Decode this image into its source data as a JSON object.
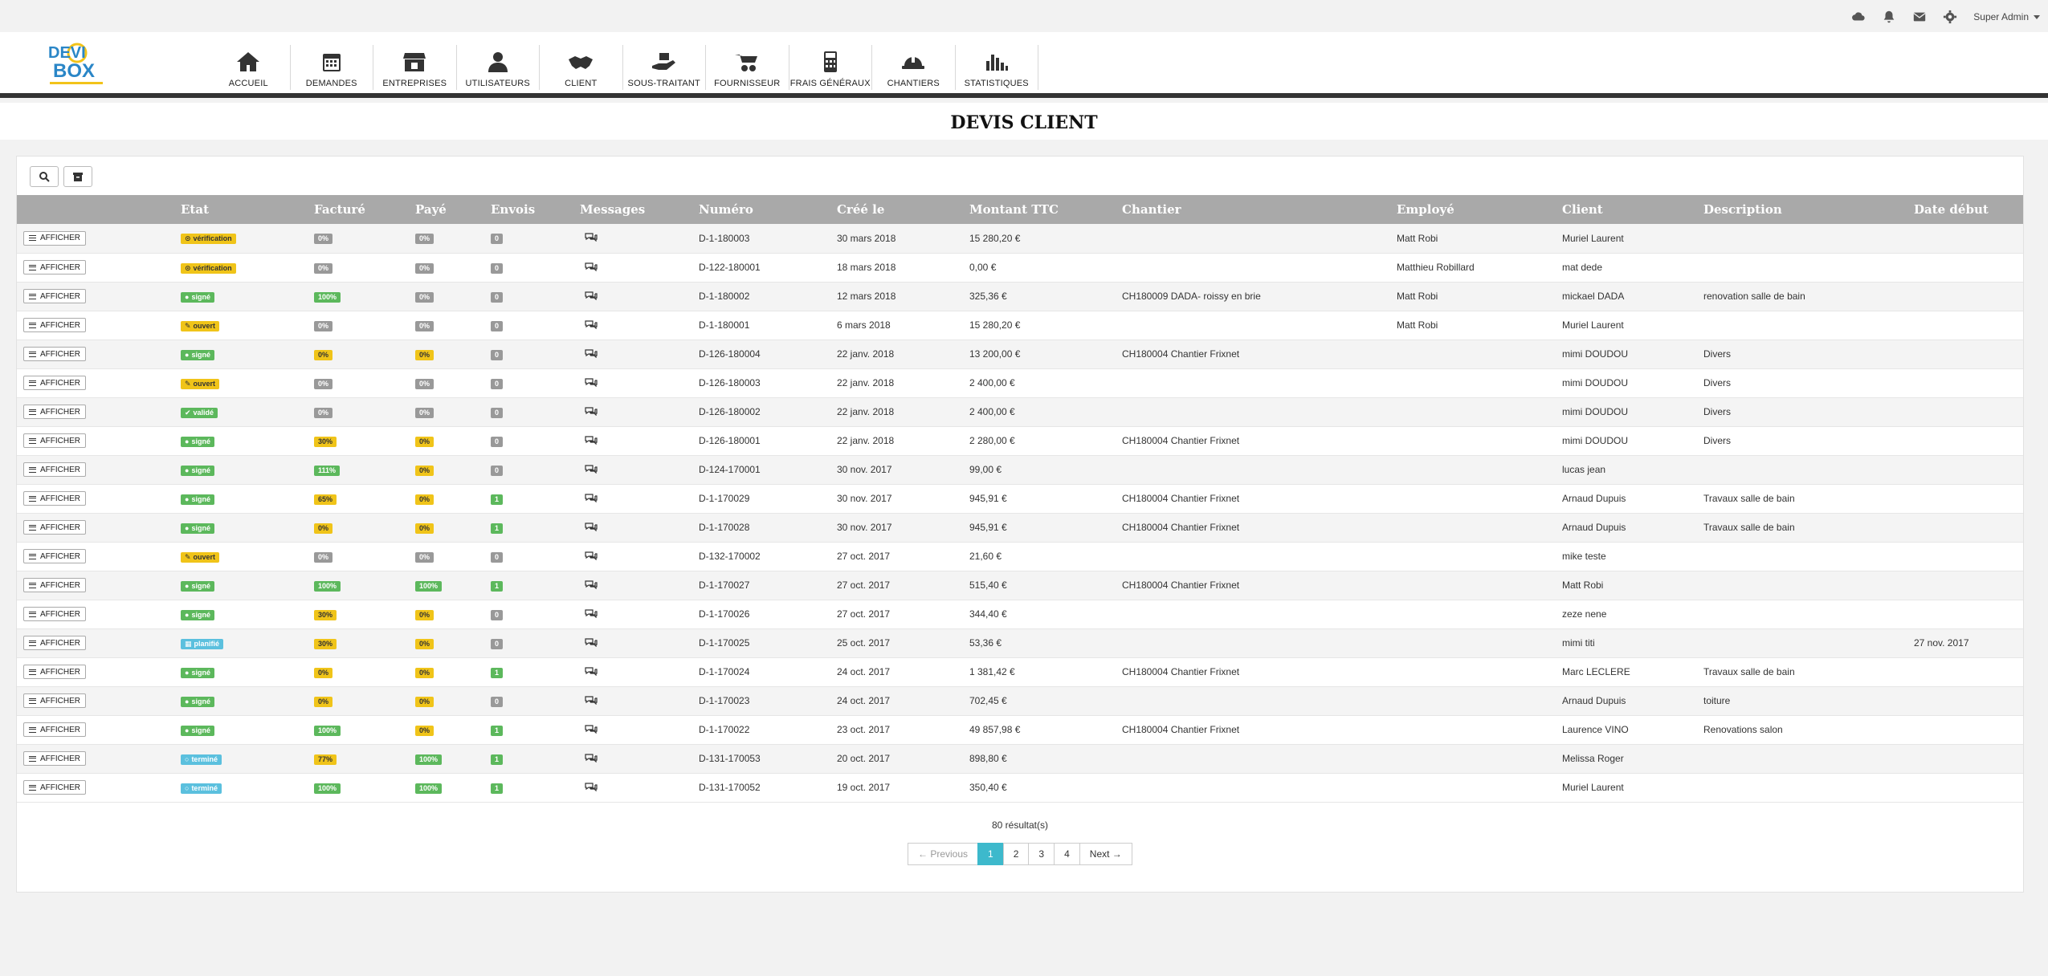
{
  "topbar": {
    "icons": [
      "cloud-icon",
      "bell-icon",
      "envelope-icon",
      "gear-icon"
    ],
    "user": "Super Admin"
  },
  "logo": {
    "line1": "DEVI",
    "line2": "BOX"
  },
  "nav": [
    {
      "label": "ACCUEIL",
      "icon": "home-icon"
    },
    {
      "label": "DEMANDES",
      "icon": "calendar-icon"
    },
    {
      "label": "ENTREPRISES",
      "icon": "store-icon"
    },
    {
      "label": "UTILISATEURS",
      "icon": "user-icon"
    },
    {
      "label": "CLIENT",
      "icon": "handshake-icon"
    },
    {
      "label": "SOUS-TRAITANT",
      "icon": "hand-holding-icon"
    },
    {
      "label": "FOURNISSEUR",
      "icon": "wheelbarrow-icon"
    },
    {
      "label": "FRAIS GÉNÉRAUX",
      "icon": "calculator-icon"
    },
    {
      "label": "CHANTIERS",
      "icon": "helmet-icon"
    },
    {
      "label": "STATISTIQUES",
      "icon": "bar-chart-icon"
    }
  ],
  "page": {
    "title": "DEVIS CLIENT"
  },
  "table": {
    "headers": [
      "",
      "Etat",
      "Facturé",
      "Payé",
      "Envois",
      "Messages",
      "Numéro",
      "Créé le",
      "Montant TTC",
      "Chantier",
      "Employé",
      "Client",
      "Description",
      "Date début"
    ],
    "button_label": "AFFICHER",
    "rows": [
      {
        "etat": "vérification",
        "etat_color": "yellow",
        "etat_icon": "⊙",
        "facture": "0%",
        "facture_color": "grey",
        "paye": "0%",
        "paye_color": "grey",
        "envois": "0",
        "envois_color": "grey",
        "numero": "D-1-180003",
        "cree": "30 mars 2018",
        "montant": "15 280,20 €",
        "chantier": "",
        "employe": "Matt Robi",
        "client": "Muriel Laurent",
        "description": "",
        "date_debut": ""
      },
      {
        "etat": "vérification",
        "etat_color": "yellow",
        "etat_icon": "⊙",
        "facture": "0%",
        "facture_color": "grey",
        "paye": "0%",
        "paye_color": "grey",
        "envois": "0",
        "envois_color": "grey",
        "numero": "D-122-180001",
        "cree": "18 mars 2018",
        "montant": "0,00 €",
        "chantier": "",
        "employe": "Matthieu Robillard",
        "client": "mat dede",
        "description": "",
        "date_debut": ""
      },
      {
        "etat": "signé",
        "etat_color": "green",
        "etat_icon": "●",
        "facture": "100%",
        "facture_color": "green",
        "paye": "0%",
        "paye_color": "grey",
        "envois": "0",
        "envois_color": "grey",
        "numero": "D-1-180002",
        "cree": "12 mars 2018",
        "montant": "325,36 €",
        "chantier": "CH180009 DADA- roissy en brie",
        "employe": "Matt Robi",
        "client": "mickael DADA",
        "description": "renovation salle de bain",
        "date_debut": ""
      },
      {
        "etat": "ouvert",
        "etat_color": "yellow",
        "etat_icon": "✎",
        "facture": "0%",
        "facture_color": "grey",
        "paye": "0%",
        "paye_color": "grey",
        "envois": "0",
        "envois_color": "grey",
        "numero": "D-1-180001",
        "cree": "6 mars 2018",
        "montant": "15 280,20 €",
        "chantier": "",
        "employe": "Matt Robi",
        "client": "Muriel Laurent",
        "description": "",
        "date_debut": ""
      },
      {
        "etat": "signé",
        "etat_color": "green",
        "etat_icon": "●",
        "facture": "0%",
        "facture_color": "yellow",
        "paye": "0%",
        "paye_color": "yellow",
        "envois": "0",
        "envois_color": "grey",
        "numero": "D-126-180004",
        "cree": "22 janv. 2018",
        "montant": "13 200,00 €",
        "chantier": "CH180004 Chantier Frixnet",
        "employe": "",
        "client": "mimi DOUDOU",
        "description": "Divers",
        "date_debut": ""
      },
      {
        "etat": "ouvert",
        "etat_color": "yellow",
        "etat_icon": "✎",
        "facture": "0%",
        "facture_color": "grey",
        "paye": "0%",
        "paye_color": "grey",
        "envois": "0",
        "envois_color": "grey",
        "numero": "D-126-180003",
        "cree": "22 janv. 2018",
        "montant": "2 400,00 €",
        "chantier": "",
        "employe": "",
        "client": "mimi DOUDOU",
        "description": "Divers",
        "date_debut": ""
      },
      {
        "etat": "validé",
        "etat_color": "green",
        "etat_icon": "✔",
        "facture": "0%",
        "facture_color": "grey",
        "paye": "0%",
        "paye_color": "grey",
        "envois": "0",
        "envois_color": "grey",
        "numero": "D-126-180002",
        "cree": "22 janv. 2018",
        "montant": "2 400,00 €",
        "chantier": "",
        "employe": "",
        "client": "mimi DOUDOU",
        "description": "Divers",
        "date_debut": ""
      },
      {
        "etat": "signé",
        "etat_color": "green",
        "etat_icon": "●",
        "facture": "30%",
        "facture_color": "yellow",
        "paye": "0%",
        "paye_color": "yellow",
        "envois": "0",
        "envois_color": "grey",
        "numero": "D-126-180001",
        "cree": "22 janv. 2018",
        "montant": "2 280,00 €",
        "chantier": "CH180004 Chantier Frixnet",
        "employe": "",
        "client": "mimi DOUDOU",
        "description": "Divers",
        "date_debut": ""
      },
      {
        "etat": "signé",
        "etat_color": "green",
        "etat_icon": "●",
        "facture": "111%",
        "facture_color": "green",
        "paye": "0%",
        "paye_color": "yellow",
        "envois": "0",
        "envois_color": "grey",
        "numero": "D-124-170001",
        "cree": "30 nov. 2017",
        "montant": "99,00 €",
        "chantier": "",
        "employe": "",
        "client": "lucas jean",
        "description": "",
        "date_debut": ""
      },
      {
        "etat": "signé",
        "etat_color": "green",
        "etat_icon": "●",
        "facture": "65%",
        "facture_color": "yellow",
        "paye": "0%",
        "paye_color": "yellow",
        "envois": "1",
        "envois_color": "green",
        "numero": "D-1-170029",
        "cree": "30 nov. 2017",
        "montant": "945,91 €",
        "chantier": "CH180004 Chantier Frixnet",
        "employe": "",
        "client": "Arnaud Dupuis",
        "description": "Travaux salle de bain",
        "date_debut": ""
      },
      {
        "etat": "signé",
        "etat_color": "green",
        "etat_icon": "●",
        "facture": "0%",
        "facture_color": "yellow",
        "paye": "0%",
        "paye_color": "yellow",
        "envois": "1",
        "envois_color": "green",
        "numero": "D-1-170028",
        "cree": "30 nov. 2017",
        "montant": "945,91 €",
        "chantier": "CH180004 Chantier Frixnet",
        "employe": "",
        "client": "Arnaud Dupuis",
        "description": "Travaux salle de bain",
        "date_debut": ""
      },
      {
        "etat": "ouvert",
        "etat_color": "yellow",
        "etat_icon": "✎",
        "facture": "0%",
        "facture_color": "grey",
        "paye": "0%",
        "paye_color": "grey",
        "envois": "0",
        "envois_color": "grey",
        "numero": "D-132-170002",
        "cree": "27 oct. 2017",
        "montant": "21,60 €",
        "chantier": "",
        "employe": "",
        "client": "mike teste",
        "description": "",
        "date_debut": ""
      },
      {
        "etat": "signé",
        "etat_color": "green",
        "etat_icon": "●",
        "facture": "100%",
        "facture_color": "green",
        "paye": "100%",
        "paye_color": "green",
        "envois": "1",
        "envois_color": "green",
        "numero": "D-1-170027",
        "cree": "27 oct. 2017",
        "montant": "515,40 €",
        "chantier": "CH180004 Chantier Frixnet",
        "employe": "",
        "client": "Matt Robi",
        "description": "",
        "date_debut": ""
      },
      {
        "etat": "signé",
        "etat_color": "green",
        "etat_icon": "●",
        "facture": "30%",
        "facture_color": "yellow",
        "paye": "0%",
        "paye_color": "yellow",
        "envois": "0",
        "envois_color": "grey",
        "numero": "D-1-170026",
        "cree": "27 oct. 2017",
        "montant": "344,40 €",
        "chantier": "",
        "employe": "",
        "client": "zeze nene",
        "description": "",
        "date_debut": ""
      },
      {
        "etat": "planifié",
        "etat_color": "blue",
        "etat_icon": "▦",
        "facture": "30%",
        "facture_color": "yellow",
        "paye": "0%",
        "paye_color": "yellow",
        "envois": "0",
        "envois_color": "grey",
        "numero": "D-1-170025",
        "cree": "25 oct. 2017",
        "montant": "53,36 €",
        "chantier": "",
        "employe": "",
        "client": "mimi titi",
        "description": "",
        "date_debut": "27 nov. 2017"
      },
      {
        "etat": "signé",
        "etat_color": "green",
        "etat_icon": "●",
        "facture": "0%",
        "facture_color": "yellow",
        "paye": "0%",
        "paye_color": "yellow",
        "envois": "1",
        "envois_color": "green",
        "numero": "D-1-170024",
        "cree": "24 oct. 2017",
        "montant": "1 381,42 €",
        "chantier": "CH180004 Chantier Frixnet",
        "employe": "",
        "client": "Marc LECLERE",
        "description": "Travaux salle de bain",
        "date_debut": ""
      },
      {
        "etat": "signé",
        "etat_color": "green",
        "etat_icon": "●",
        "facture": "0%",
        "facture_color": "yellow",
        "paye": "0%",
        "paye_color": "yellow",
        "envois": "0",
        "envois_color": "grey",
        "numero": "D-1-170023",
        "cree": "24 oct. 2017",
        "montant": "702,45 €",
        "chantier": "",
        "employe": "",
        "client": "Arnaud Dupuis",
        "description": "toiture",
        "date_debut": ""
      },
      {
        "etat": "signé",
        "etat_color": "green",
        "etat_icon": "●",
        "facture": "100%",
        "facture_color": "green",
        "paye": "0%",
        "paye_color": "yellow",
        "envois": "1",
        "envois_color": "green",
        "numero": "D-1-170022",
        "cree": "23 oct. 2017",
        "montant": "49 857,98 €",
        "chantier": "CH180004 Chantier Frixnet",
        "employe": "",
        "client": "Laurence VINO",
        "description": "Renovations salon",
        "date_debut": ""
      },
      {
        "etat": "terminé",
        "etat_color": "blue",
        "etat_icon": "○",
        "facture": "77%",
        "facture_color": "yellow",
        "paye": "100%",
        "paye_color": "green",
        "envois": "1",
        "envois_color": "green",
        "numero": "D-131-170053",
        "cree": "20 oct. 2017",
        "montant": "898,80 €",
        "chantier": "",
        "employe": "",
        "client": "Melissa Roger",
        "description": "",
        "date_debut": ""
      },
      {
        "etat": "terminé",
        "etat_color": "blue",
        "etat_icon": "○",
        "facture": "100%",
        "facture_color": "green",
        "paye": "100%",
        "paye_color": "green",
        "envois": "1",
        "envois_color": "green",
        "numero": "D-131-170052",
        "cree": "19 oct. 2017",
        "montant": "350,40 €",
        "chantier": "",
        "employe": "",
        "client": "Muriel Laurent",
        "description": "",
        "date_debut": ""
      }
    ]
  },
  "results": "80 résultat(s)",
  "pagination": {
    "previous": "← Previous",
    "pages": [
      "1",
      "2",
      "3",
      "4"
    ],
    "active": "1",
    "next": "Next →"
  },
  "colors": {
    "green": "#5cb85c",
    "yellow": "#f0c419",
    "grey": "#999999",
    "blue": "#5bc0de",
    "accent": "#3db9cc"
  }
}
